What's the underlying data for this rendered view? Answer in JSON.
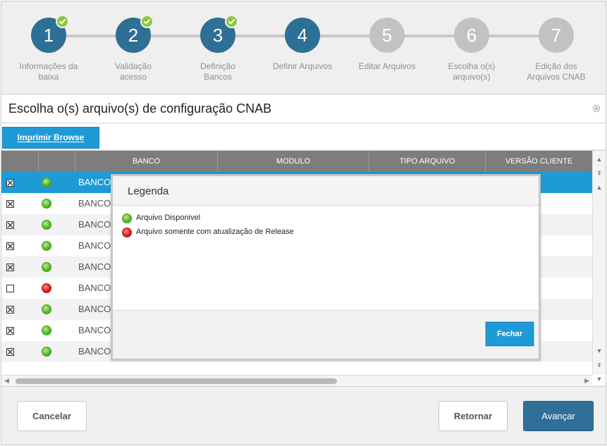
{
  "wizard": {
    "steps": [
      {
        "number": "1",
        "label_line1": "Informações da",
        "label_line2": "baixa",
        "state": "done"
      },
      {
        "number": "2",
        "label_line1": "Validação",
        "label_line2": "acesso",
        "state": "done"
      },
      {
        "number": "3",
        "label_line1": "Definição",
        "label_line2": "Bancos",
        "state": "done"
      },
      {
        "number": "4",
        "label_line1": "Definir Arquivos",
        "label_line2": "",
        "state": "current"
      },
      {
        "number": "5",
        "label_line1": "Editar Arquivos",
        "label_line2": "",
        "state": "todo"
      },
      {
        "number": "6",
        "label_line1": "Escolha o(s)",
        "label_line2": "arquivo(s)",
        "state": "todo"
      },
      {
        "number": "7",
        "label_line1": "Edição dos",
        "label_line2": "Arquivos CNAB",
        "state": "todo"
      }
    ]
  },
  "section": {
    "title": "Escolha o(s) arquivo(s) de configuração CNAB",
    "settings_icon": "gear-icon"
  },
  "toolbar": {
    "print_label": "Imprimir Browse"
  },
  "grid": {
    "columns": [
      "",
      "",
      "BANCO",
      "MODULO",
      "TIPO ARQUIVO",
      "VERSÃO CLIENTE"
    ],
    "rows": [
      {
        "checked": true,
        "status": "green",
        "bank": "BANCO",
        "selected": true
      },
      {
        "checked": true,
        "status": "green",
        "bank": "BANCO",
        "selected": false
      },
      {
        "checked": true,
        "status": "green",
        "bank": "BANCO",
        "selected": false
      },
      {
        "checked": true,
        "status": "green",
        "bank": "BANCO",
        "selected": false
      },
      {
        "checked": true,
        "status": "green",
        "bank": "BANCO",
        "selected": false
      },
      {
        "checked": false,
        "status": "red",
        "bank": "BANCO",
        "selected": false
      },
      {
        "checked": true,
        "status": "green",
        "bank": "BANCO",
        "selected": false
      },
      {
        "checked": true,
        "status": "green",
        "bank": "BANCO",
        "selected": false
      },
      {
        "checked": true,
        "status": "green",
        "bank": "BANCO",
        "selected": false
      }
    ]
  },
  "modal": {
    "title": "Legenda",
    "items": [
      {
        "color": "green",
        "text": "Arquivo Disponivel"
      },
      {
        "color": "red",
        "text": "Arquivo somente com atualização de Release"
      }
    ],
    "close_label": "Fechar"
  },
  "footer": {
    "cancel_label": "Cancelar",
    "back_label": "Retornar",
    "next_label": "Avançar"
  },
  "colors": {
    "accent": "#1e9bd7",
    "step_active": "#2e6f95",
    "step_inactive": "#c2c2c2",
    "check_green": "#8cc63f"
  }
}
